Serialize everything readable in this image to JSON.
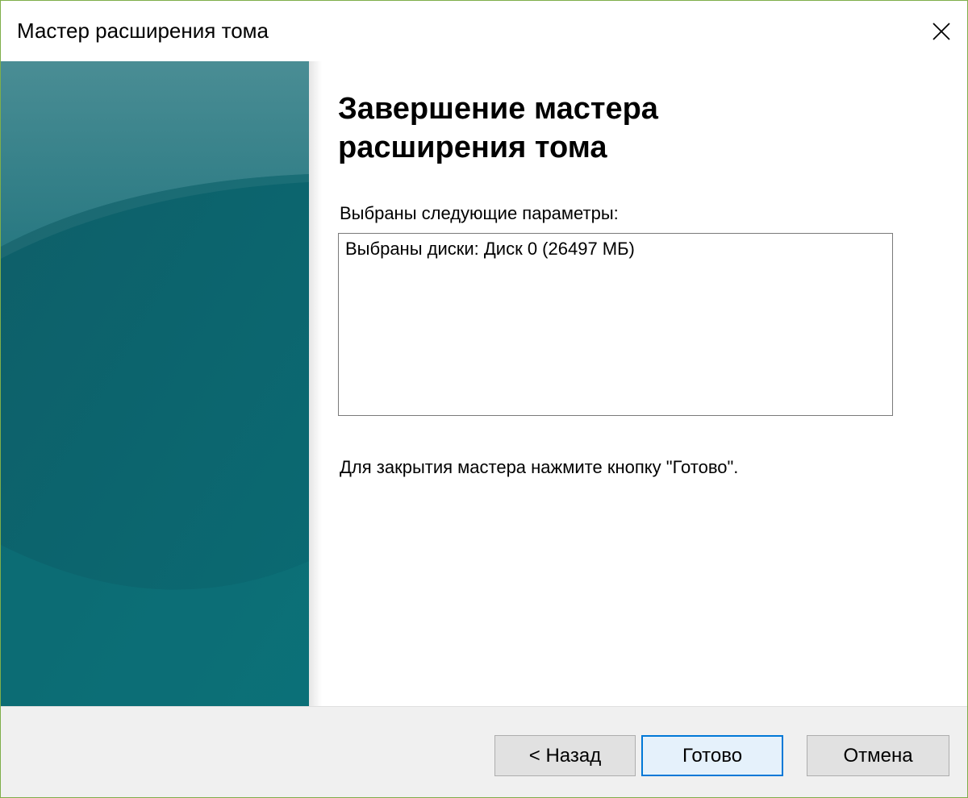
{
  "window": {
    "title": "Мастер расширения тома"
  },
  "icons": {
    "close": "close-icon"
  },
  "colors": {
    "window_border": "#7fae4a",
    "sidebar_teal": "#0e6f78",
    "footer_bg": "#f0f0f0",
    "default_button_border": "#0078d7"
  },
  "content": {
    "heading": "Завершение мастера расширения тома",
    "params_label": "Выбраны следующие параметры:",
    "params_lines": [
      "Выбраны диски: Диск 0 (26497 МБ)"
    ],
    "finish_text": "Для закрытия мастера нажмите кнопку \"Готово\"."
  },
  "buttons": {
    "back": "< Назад",
    "finish": "Готово",
    "cancel": "Отмена"
  }
}
